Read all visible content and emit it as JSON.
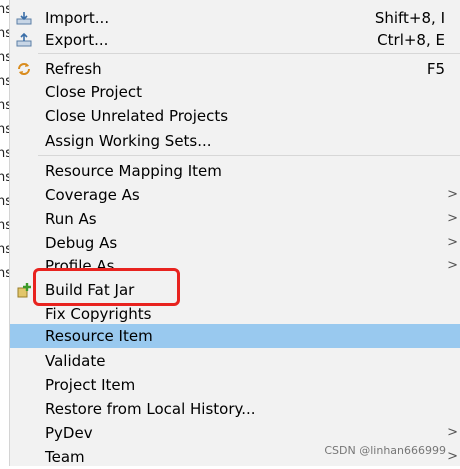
{
  "left_fragments": [
    "ns",
    "ns",
    "ns",
    "ns",
    "ns",
    "ns",
    "ns",
    "ns",
    "ns",
    "ns",
    "ns",
    "ns"
  ],
  "menu": {
    "items": [
      {
        "label": "Import...",
        "accel": "Shift+8, I",
        "icon": "import-icon"
      },
      {
        "label": "Export...",
        "accel": "Ctrl+8, E",
        "icon": "export-icon"
      },
      {
        "label": "Refresh",
        "accel": "F5",
        "icon": "refresh-icon"
      },
      {
        "label": "Close Project"
      },
      {
        "label": "Close Unrelated Projects"
      },
      {
        "label": "Assign Working Sets..."
      },
      {
        "label": "Resource Mapping Item"
      },
      {
        "label": "Coverage As",
        "submenu": true
      },
      {
        "label": "Run As",
        "submenu": true
      },
      {
        "label": "Debug As",
        "submenu": true
      },
      {
        "label": "Profile As",
        "submenu": true
      },
      {
        "label": "Build Fat Jar",
        "icon": "add-plugin-icon"
      },
      {
        "label": "Fix Copyrights"
      },
      {
        "label": "Resource Item",
        "selected": true
      },
      {
        "label": "Validate"
      },
      {
        "label": "Project Item"
      },
      {
        "label": "Restore from Local History..."
      },
      {
        "label": "PyDev",
        "submenu": true
      },
      {
        "label": "Team",
        "submenu": true
      }
    ],
    "submenu_arrow": ">"
  },
  "colors": {
    "selection": "#99c9ef",
    "highlight_border": "#e8231f",
    "menu_background": "#f2f2f2"
  },
  "watermark": "CSDN @linhan666999"
}
